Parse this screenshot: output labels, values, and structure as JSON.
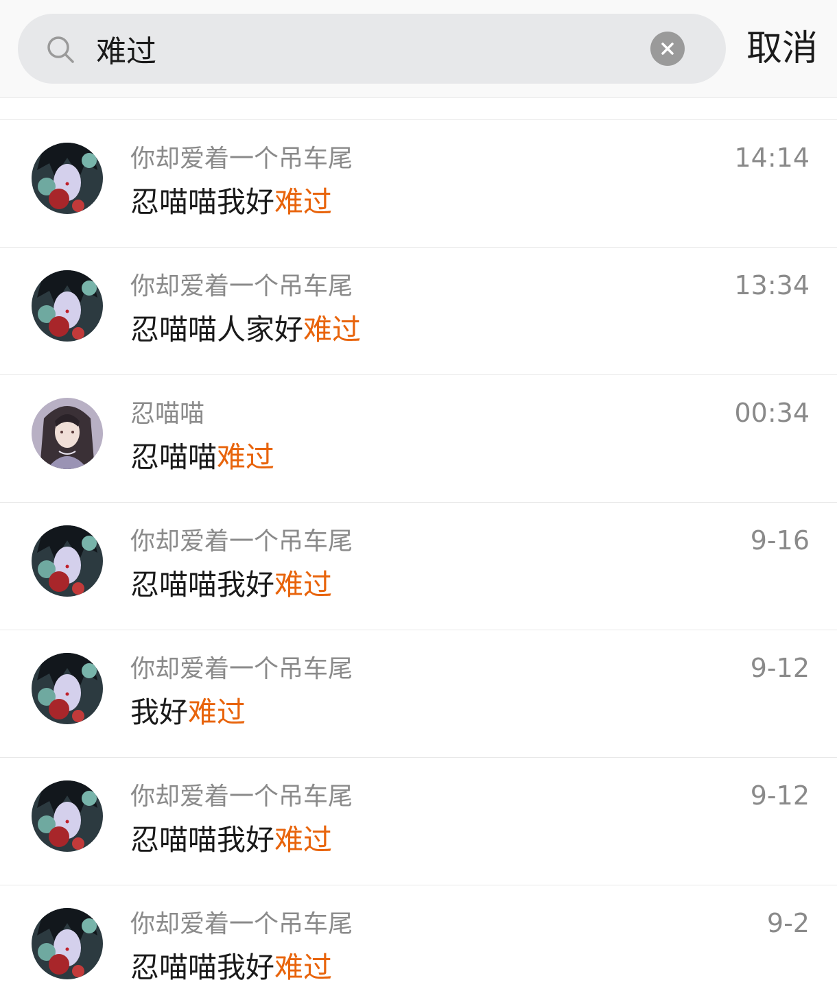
{
  "search": {
    "query": "难过",
    "cancel_label": "取消"
  },
  "results": [
    {
      "sender": "你却爱着一个吊车尾",
      "message_prefix": "忍喵喵我好",
      "highlight": "难过",
      "time": "14:14",
      "avatar": "uchiha-avatar"
    },
    {
      "sender": "你却爱着一个吊车尾",
      "message_prefix": "忍喵喵人家好",
      "highlight": "难过",
      "time": "13:34",
      "avatar": "uchiha-avatar"
    },
    {
      "sender": "忍喵喵",
      "message_prefix": "忍喵喵",
      "highlight": "难过",
      "time": "00:34",
      "avatar": "girl-avatar"
    },
    {
      "sender": "你却爱着一个吊车尾",
      "message_prefix": "忍喵喵我好",
      "highlight": "难过",
      "time": "9-16",
      "avatar": "uchiha-avatar"
    },
    {
      "sender": "你却爱着一个吊车尾",
      "message_prefix": "我好",
      "highlight": "难过",
      "time": "9-12",
      "avatar": "uchiha-avatar"
    },
    {
      "sender": "你却爱着一个吊车尾",
      "message_prefix": "忍喵喵我好",
      "highlight": "难过",
      "time": "9-12",
      "avatar": "uchiha-avatar"
    },
    {
      "sender": "你却爱着一个吊车尾",
      "message_prefix": "忍喵喵我好",
      "highlight": "难过",
      "time": "9-2",
      "avatar": "uchiha-avatar"
    }
  ],
  "colors": {
    "highlight": "#e8640c",
    "secondary_text": "#8a8a8a",
    "search_box_bg": "#e7e8ea"
  }
}
